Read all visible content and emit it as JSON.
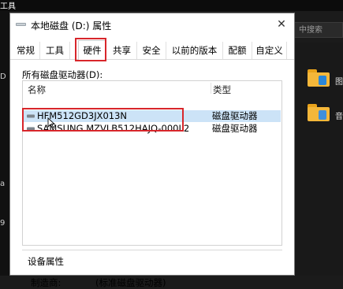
{
  "background": {
    "corner_label": "工具",
    "search_placeholder": "中搜索",
    "folder_labels": [
      "图",
      "音"
    ],
    "left_marks": [
      "D",
      "a",
      "9"
    ]
  },
  "dialog": {
    "title": "本地磁盘 (D:) 属性",
    "close_symbol": "✕",
    "tabs": [
      {
        "label": "常规"
      },
      {
        "label": "工具"
      },
      {
        "label": "硬件"
      },
      {
        "label": "共享"
      },
      {
        "label": "安全"
      },
      {
        "label": "以前的版本"
      },
      {
        "label": "配额"
      },
      {
        "label": "自定义"
      }
    ],
    "active_tab": "硬件",
    "section_label": "所有磁盘驱动器(D):",
    "columns": {
      "name": "名称",
      "type": "类型"
    },
    "drives": [
      {
        "name": "HFM512GD3JX013N",
        "type": "磁盘驱动器",
        "selected": true
      },
      {
        "name": "SAMSUNG MZVLB512HAJQ-000L2",
        "type": "磁盘驱动器",
        "selected": false
      }
    ],
    "properties_group": "设备属性",
    "properties": [
      {
        "label": "制造商:",
        "value": "(标准磁盘驱动器)"
      }
    ]
  },
  "colors": {
    "highlight_red": "#d8262b",
    "selection_blue": "#cce3f7",
    "folder_yellow": "#f4b73a"
  }
}
